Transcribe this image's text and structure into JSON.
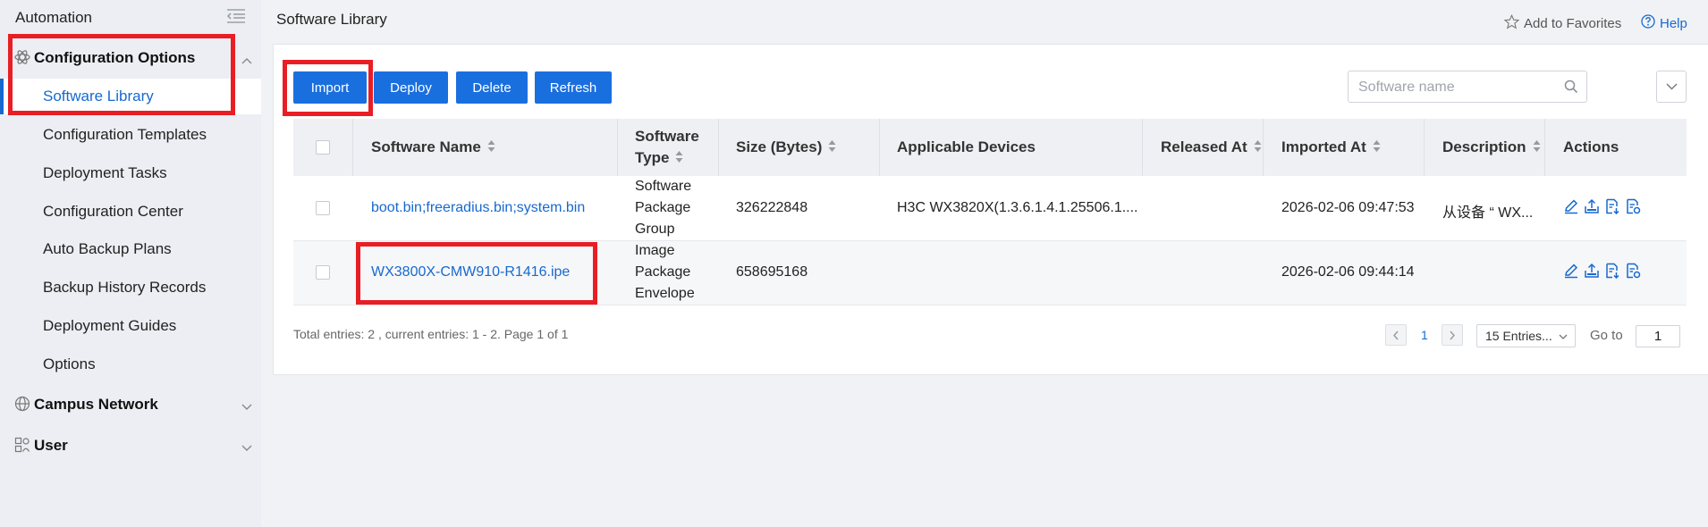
{
  "sidebar": {
    "top_label": "Automation",
    "config_group": "Configuration Options",
    "items": [
      {
        "label": "Software Library"
      },
      {
        "label": "Configuration Templates"
      },
      {
        "label": "Deployment Tasks"
      },
      {
        "label": "Configuration Center"
      },
      {
        "label": "Auto Backup Plans"
      },
      {
        "label": "Backup History Records"
      },
      {
        "label": "Deployment Guides"
      },
      {
        "label": "Options"
      }
    ],
    "campus_group": "Campus Network",
    "user_group": "User"
  },
  "header": {
    "title": "Software Library",
    "favorites": "Add to Favorites",
    "help": "Help"
  },
  "toolbar": {
    "import": "Import",
    "deploy": "Deploy",
    "delete": "Delete",
    "refresh": "Refresh",
    "search_placeholder": "Software name"
  },
  "table": {
    "columns": {
      "name": "Software Name",
      "type_line1": "Software",
      "type_line2": "Type",
      "size": "Size (Bytes)",
      "devices": "Applicable Devices",
      "released": "Released At",
      "imported": "Imported At",
      "description": "Description",
      "actions": "Actions"
    },
    "rows": [
      {
        "name": "boot.bin;freeradius.bin;system.bin",
        "type": [
          "Software",
          "Package",
          "Group"
        ],
        "size": "326222848",
        "devices": "H3C WX3820X(1.3.6.1.4.1.25506.1....",
        "released": "",
        "imported": "2026-02-06 09:47:53",
        "description": "从设备 “ WX..."
      },
      {
        "name": "WX3800X-CMW910-R1416.ipe",
        "type": [
          "Image",
          "Package",
          "Envelope"
        ],
        "size": "658695168",
        "devices": "",
        "released": "",
        "imported": "2026-02-06 09:44:14",
        "description": ""
      }
    ]
  },
  "pagination": {
    "total": "Total entries: 2 , current entries: 1 - 2. Page 1 of 1",
    "current_page": "1",
    "page_size": "15 Entries...",
    "goto_label": "Go to",
    "goto_value": "1"
  },
  "icons": {
    "edit": "edit-icon",
    "export": "export-icon",
    "import": "download-doc-icon",
    "detail": "detail-doc-icon"
  },
  "colors": {
    "accent": "#1a6fdf",
    "link": "#1769cf",
    "highlight": "#e81e24"
  }
}
